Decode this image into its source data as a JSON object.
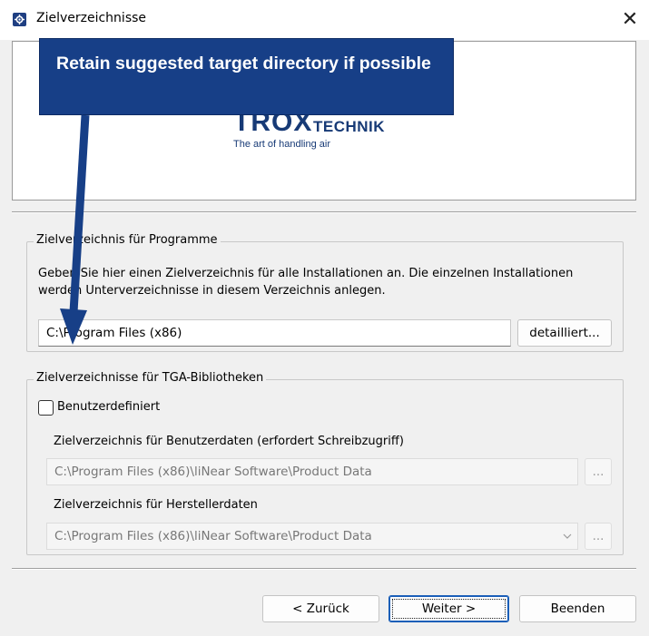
{
  "window": {
    "title": "Zielverzeichnisse",
    "close_glyph": "✕",
    "icon": "gear-icon"
  },
  "banner": {
    "logo_brand": "TROX",
    "logo_suffix": "TECHNIK",
    "logo_slogan": "The art of handling air",
    "brand_color": "#173a76"
  },
  "annotation": {
    "text": "Retain suggested target directory if possible",
    "box_color": "#173f87"
  },
  "programs_group": {
    "legend": "Zielverzeichnis für Programme",
    "description": "Geben Sie hier einen Zielverzeichnis für alle Installationen an. Die einzelnen Installationen werden Unterverzeichnisse in diesem Verzeichnis anlegen.",
    "path_value": "C:\\Program Files (x86)",
    "detail_button": "detailliert..."
  },
  "tga_group": {
    "legend": "Zielverzeichnisse für TGA-Bibliotheken",
    "custom_checkbox_label": "Benutzerdefiniert",
    "custom_checked": false,
    "userdata_label": "Zielverzeichnis für Benutzerdaten (erfordert Schreibzugriff)",
    "userdata_value": "C:\\Program Files (x86)\\liNear Software\\Product Data",
    "vendordata_label": "Zielverzeichnis für Herstellerdaten",
    "vendordata_value": "C:\\Program Files (x86)\\liNear Software\\Product Data",
    "browse_label": "..."
  },
  "footer": {
    "back_button": "< Zurück",
    "next_button": "Weiter >",
    "finish_button": "Beenden"
  }
}
